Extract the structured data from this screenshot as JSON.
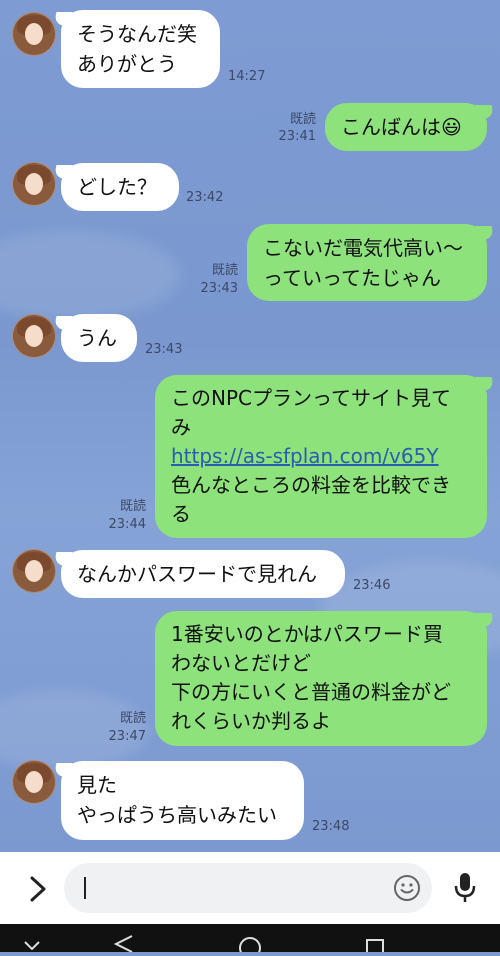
{
  "messages": [
    {
      "side": "in",
      "lines": [
        "そうなんだ笑",
        "ありがとう"
      ],
      "time": "14:27"
    },
    {
      "side": "out",
      "lines": [
        "こんばんは😃"
      ],
      "read": "既読",
      "time": "23:41"
    },
    {
      "side": "in",
      "lines": [
        "どした？"
      ],
      "time": "23:42"
    },
    {
      "side": "out",
      "lines": [
        "こないだ電気代高い〜",
        "っていってたじゃん"
      ],
      "read": "既読",
      "time": "23:43"
    },
    {
      "side": "in",
      "lines": [
        "うん"
      ],
      "time": "23:43"
    },
    {
      "side": "out",
      "lines": [
        "このNPCプランってサイト見て",
        "み",
        "https://as-sfplan.com/v65Y",
        "色んなところの料金を比較でき",
        "る"
      ],
      "read": "既読",
      "time": "23:44"
    },
    {
      "side": "in",
      "lines": [
        "なんかパスワードで見れん"
      ],
      "time": "23:46"
    },
    {
      "side": "out",
      "lines": [
        "1番安いのとかはパスワード買",
        "わないとだけど",
        "下の方にいくと普通の料金がど",
        "れくらいか判るよ"
      ],
      "read": "既読",
      "time": "23:47"
    },
    {
      "side": "in",
      "lines": [
        "見た",
        "やっぱうち高いみたい"
      ],
      "time": "23:48"
    }
  ],
  "input": {
    "value": ""
  },
  "icons": {
    "expand": "chevron-right-icon",
    "emoji": "emoji-icon",
    "mic": "microphone-icon",
    "back": "nav-back-icon",
    "home": "nav-home-icon",
    "recent": "nav-recent-icon",
    "hide": "nav-hide-icon"
  },
  "colors": {
    "background": "#7d9bd1",
    "outgoing": "#8ee27b",
    "incoming": "#ffffff",
    "link": "#2a5db0"
  }
}
